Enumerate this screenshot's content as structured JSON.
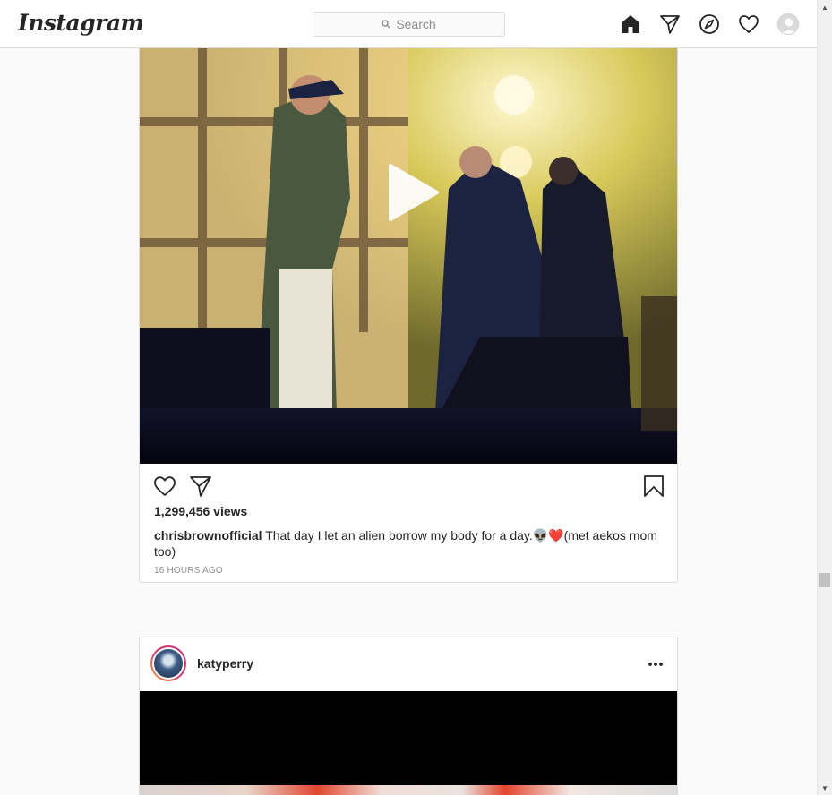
{
  "nav": {
    "logo": "Instagram",
    "search_placeholder": "Search",
    "icons": [
      "home-icon",
      "direct-icon",
      "explore-icon",
      "activity-heart-icon",
      "profile-avatar"
    ]
  },
  "post1": {
    "views": "1,299,456 views",
    "username": "chrisbrownofficial",
    "caption_text": "That day I let an alien borrow my body for a day.",
    "caption_emoji": "👽❤️",
    "caption_tail": "(met aekos mom too)",
    "time": "16 HOURS AGO",
    "icons": [
      "like-heart-icon",
      "share-icon",
      "bookmark-icon",
      "play-icon"
    ]
  },
  "post2": {
    "username": "katyperry",
    "icons": [
      "more-options-icon"
    ]
  },
  "colors": {
    "border": "#dbdbdb",
    "text": "#262626",
    "muted": "#8e8e8e",
    "background": "#fafafa"
  }
}
